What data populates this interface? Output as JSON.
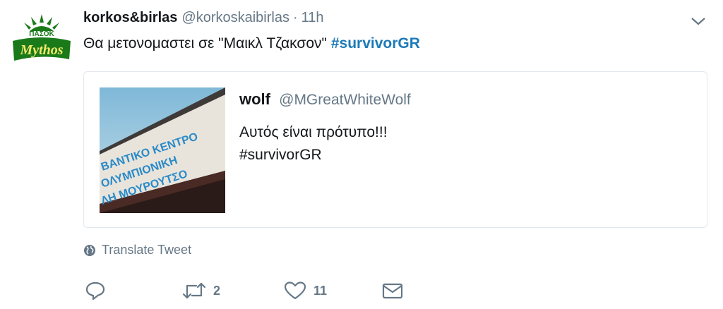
{
  "tweet": {
    "display_name": "korkos&birlas",
    "handle": "@korkoskaibirlas",
    "separator": "·",
    "time": "11h",
    "text": "Θα μετονομαστει σε \"Μαικλ Τζακσον\"",
    "hashtag": "#survivorGR"
  },
  "avatar": {
    "logo_top_text": "ΠΑΣΟΚ",
    "logo_main_text": "Mythos",
    "logo_color": "#1a7a1a"
  },
  "quoted_tweet": {
    "display_name": "wolf",
    "handle": "@MGreatWhiteWolf",
    "text_line1": "Αυτός είναι πρότυπο!!!",
    "text_line2": "#survivorGR",
    "media_sign_lines": [
      "ΒΑΝΤΙΚΟ ΚΕΝΤΡΟ",
      "ΟΛΥΜΠΙΟΝΙΚΗ",
      "ΛΗ ΜΟΥΡΟΥΤΣΟ"
    ]
  },
  "translate": {
    "label": "Translate Tweet",
    "icon": "globe-icon"
  },
  "actions": {
    "reply_icon": "reply-icon",
    "retweet_icon": "retweet-icon",
    "retweet_count": "2",
    "like_icon": "heart-icon",
    "like_count": "11",
    "dm_icon": "envelope-icon"
  },
  "colors": {
    "hashtag": "#1c7ab8",
    "secondary_text": "#657786",
    "border": "#e1e8ed"
  }
}
